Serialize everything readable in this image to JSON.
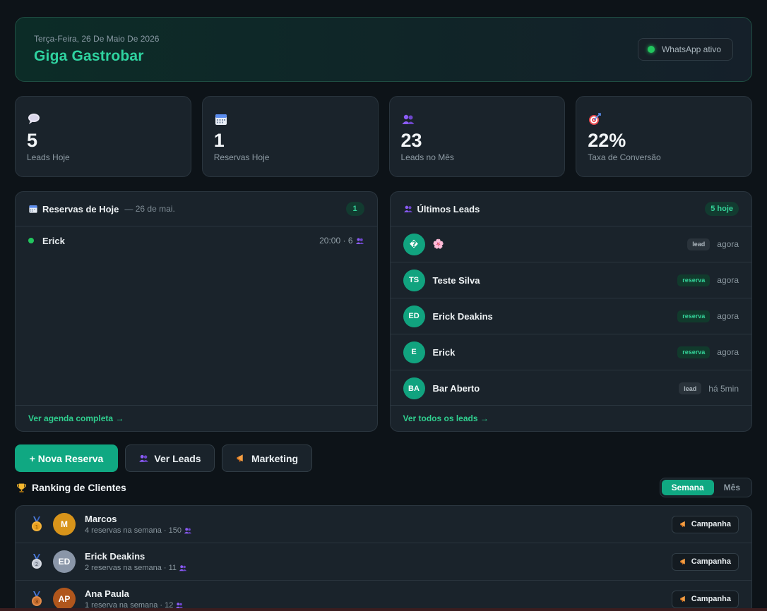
{
  "header": {
    "date": "Terça-Feira, 26 De Maio De 2026",
    "title": "Giga Gastrobar",
    "whatsapp_status": "WhatsApp ativo"
  },
  "stats": [
    {
      "icon": "chat-bubble-icon",
      "value": "5",
      "label": "Leads Hoje"
    },
    {
      "icon": "calendar-icon",
      "value": "1",
      "label": "Reservas Hoje"
    },
    {
      "icon": "people-icon",
      "value": "23",
      "label": "Leads no Mês"
    },
    {
      "icon": "target-icon",
      "value": "22%",
      "label": "Taxa de Conversão"
    }
  ],
  "reservations": {
    "title": "Reservas de Hoje",
    "subtitle": "— 26 de mai.",
    "count": "1",
    "items": [
      {
        "name": "Erick",
        "detail": "20:00 · 6"
      }
    ],
    "footer_link": "Ver agenda completa →"
  },
  "leads": {
    "title": "Últimos Leads",
    "badge": "5 hoje",
    "items": [
      {
        "initials": "�",
        "name": "🌸",
        "tag": "lead",
        "time": "agora"
      },
      {
        "initials": "TS",
        "name": "Teste Silva",
        "tag": "reserva",
        "time": "agora"
      },
      {
        "initials": "ED",
        "name": "Erick Deakins",
        "tag": "reserva",
        "time": "agora"
      },
      {
        "initials": "E",
        "name": "Erick",
        "tag": "reserva",
        "time": "agora"
      },
      {
        "initials": "BA",
        "name": "Bar Aberto",
        "tag": "lead",
        "time": "há 5min"
      }
    ],
    "footer_link": "Ver todos os leads →"
  },
  "actions": {
    "new_reservation": "+  Nova Reserva",
    "view_leads": "Ver Leads",
    "marketing": "Marketing"
  },
  "ranking": {
    "title": "Ranking de Clientes",
    "toggle_week": "Semana",
    "toggle_month": "Mês",
    "campaign_label": "Campanha",
    "items": [
      {
        "medal": "1",
        "initials": "M",
        "name": "Marcos",
        "detail": "4 reservas na semana · 150",
        "avatar_color": "#d8941a"
      },
      {
        "medal": "2",
        "initials": "ED",
        "name": "Erick Deakins",
        "detail": "2 reservas na semana · 11",
        "avatar_color": "#8a96a8"
      },
      {
        "medal": "3",
        "initials": "AP",
        "name": "Ana Paula",
        "detail": "1 reserva na semana · 12",
        "avatar_color": "#b0561c"
      }
    ]
  },
  "colors": {
    "accent": "#10a882",
    "title_gradient_start": "#2fd3a0",
    "status_green": "#22c55e",
    "background": "#0d1318",
    "card": "#1a232b"
  }
}
